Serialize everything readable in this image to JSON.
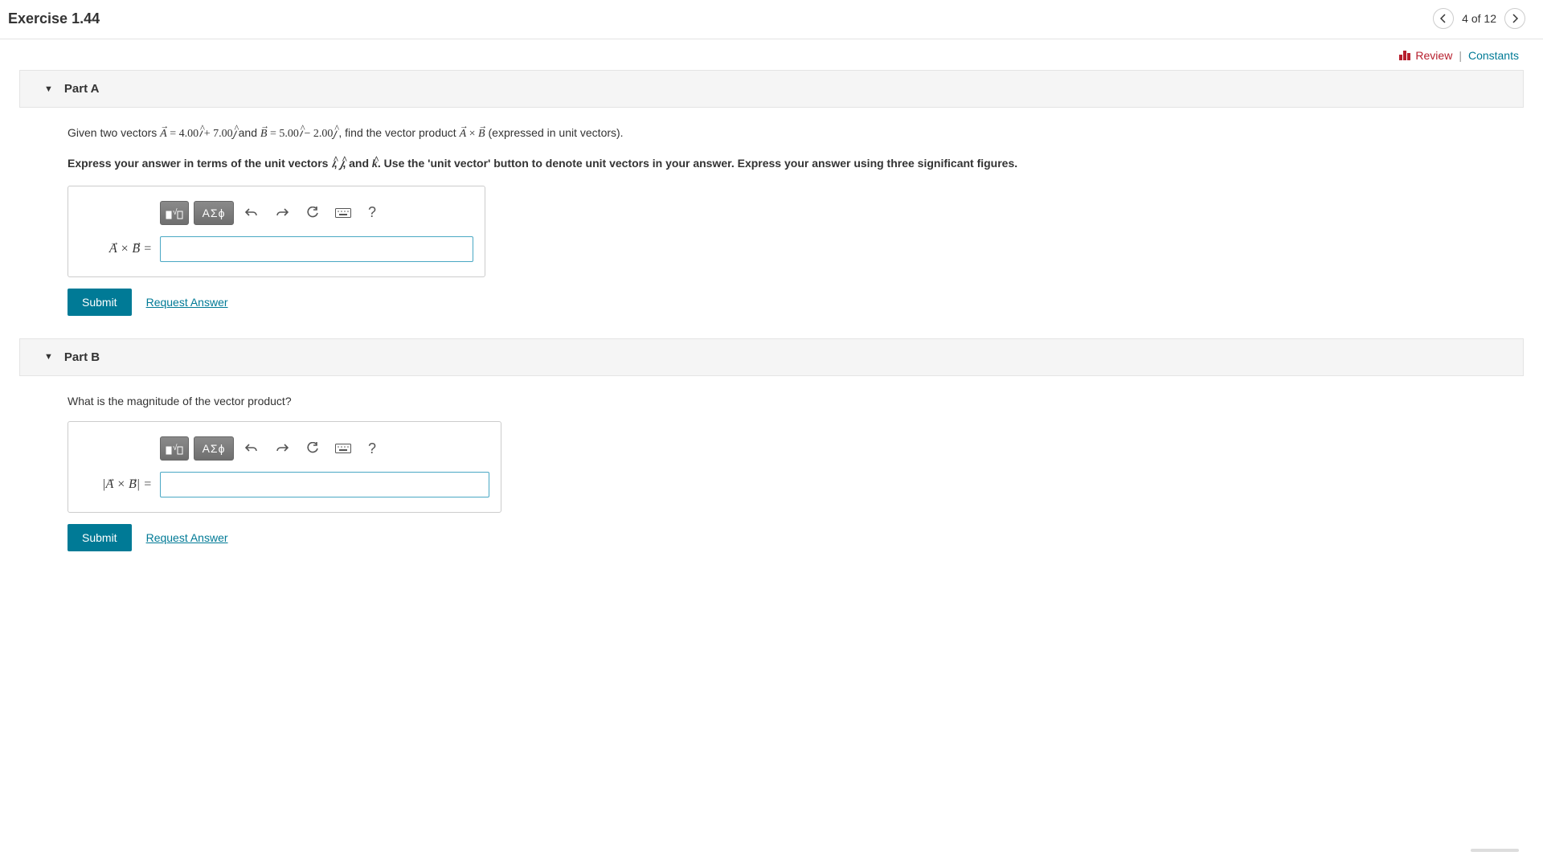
{
  "header": {
    "title": "Exercise 1.44",
    "progress": "4 of 12"
  },
  "subheader": {
    "review": "Review",
    "constants": "Constants"
  },
  "partA": {
    "title": "Part A",
    "question_pre": "Given two vectors ",
    "question_mid1": " and ",
    "question_mid2": " , find the vector product ",
    "question_post": " (expressed in unit vectors).",
    "vecA_eq": " = 4.00",
    "vecA_plus": " + 7.00",
    "vecB_eq": " = 5.00",
    "vecB_minus": " − 2.00",
    "cross": " × ",
    "instruction_pre": "Express your answer in terms of the unit vectors ",
    "instruction_mid": ", and ",
    "instruction_post": ". Use the 'unit vector' button to denote unit vectors in your answer. Express your answer using three significant figures.",
    "comma": ", ",
    "eq_label_pre": "A",
    "eq_label_cross": " × ",
    "eq_label_post": "B",
    "eq_label_eq": " = ",
    "submit": "Submit",
    "request": "Request Answer",
    "toolbar": {
      "templates": "■√☐",
      "greek": "ΑΣϕ",
      "help": "?"
    }
  },
  "partB": {
    "title": "Part B",
    "question": "What is the magnitude of the vector product?",
    "eq_label": "|A × B| = ",
    "submit": "Submit",
    "request": "Request Answer",
    "toolbar": {
      "templates": "■√☐",
      "greek": "ΑΣϕ",
      "help": "?"
    }
  }
}
